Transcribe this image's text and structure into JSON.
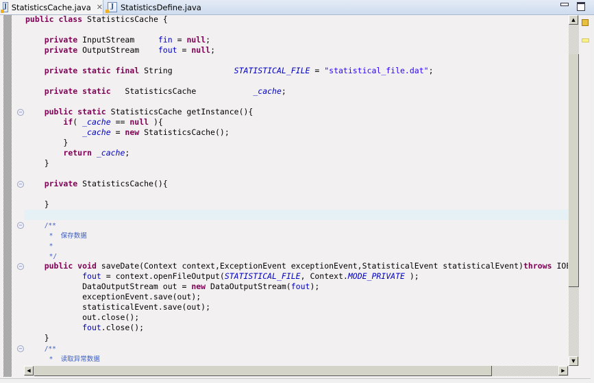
{
  "tabs": [
    {
      "label": "StatisticsCache.java",
      "active": true,
      "icon": "java-file-warning-icon",
      "close_icon": "close-icon"
    },
    {
      "label": "StatisticsDefine.java",
      "active": false,
      "icon": "java-file-warning-icon"
    }
  ],
  "window_controls": {
    "minimize": "minimize-icon",
    "maximize": "maximize-icon"
  },
  "colors": {
    "keyword": "#7f0055",
    "field": "#0000c0",
    "string": "#2a00ff",
    "javadoc": "#3f5fbf",
    "current_line": "#e6f1f5"
  },
  "fold_lines": [
    10,
    17,
    21,
    25,
    33
  ],
  "code_lines": [
    [
      [
        "k",
        "public class "
      ],
      [
        "t",
        "StatisticsCache {"
      ]
    ],
    [],
    [
      [
        "t",
        "    "
      ],
      [
        "k",
        "private "
      ],
      [
        "t",
        "InputStream     "
      ],
      [
        "f",
        "fin"
      ],
      [
        "t",
        " = "
      ],
      [
        "k",
        "null"
      ],
      [
        "t",
        ";"
      ]
    ],
    [
      [
        "t",
        "    "
      ],
      [
        "k",
        "private "
      ],
      [
        "t",
        "OutputStream    "
      ],
      [
        "f",
        "fout"
      ],
      [
        "t",
        " = "
      ],
      [
        "k",
        "null"
      ],
      [
        "t",
        ";"
      ]
    ],
    [],
    [
      [
        "t",
        "    "
      ],
      [
        "k",
        "private static final "
      ],
      [
        "t",
        "String             "
      ],
      [
        "s",
        "STATISTICAL_FILE"
      ],
      [
        "t",
        " = "
      ],
      [
        "str",
        "\"statistical_file.dat\""
      ],
      [
        "t",
        ";"
      ]
    ],
    [],
    [
      [
        "t",
        "    "
      ],
      [
        "k",
        "private static   "
      ],
      [
        "t",
        "StatisticsCache            "
      ],
      [
        "s",
        "_cache"
      ],
      [
        "t",
        ";"
      ]
    ],
    [],
    [
      [
        "t",
        "    "
      ],
      [
        "k",
        "public static "
      ],
      [
        "t",
        "StatisticsCache getInstance(){"
      ]
    ],
    [
      [
        "t",
        "        "
      ],
      [
        "k",
        "if"
      ],
      [
        "t",
        "( "
      ],
      [
        "s",
        "_cache"
      ],
      [
        "t",
        " == "
      ],
      [
        "k",
        "null"
      ],
      [
        "t",
        " ){"
      ]
    ],
    [
      [
        "t",
        "            "
      ],
      [
        "s",
        "_cache"
      ],
      [
        "t",
        " = "
      ],
      [
        "k",
        "new "
      ],
      [
        "t",
        "StatisticsCache();"
      ]
    ],
    [
      [
        "t",
        "        }"
      ]
    ],
    [
      [
        "t",
        "        "
      ],
      [
        "k",
        "return "
      ],
      [
        "s",
        "_cache"
      ],
      [
        "t",
        ";"
      ]
    ],
    [
      [
        "t",
        "    }"
      ]
    ],
    [],
    [
      [
        "t",
        "    "
      ],
      [
        "k",
        "private "
      ],
      [
        "t",
        "StatisticsCache(){"
      ]
    ],
    [],
    [
      [
        "t",
        "    }"
      ]
    ],
    [],
    [
      [
        "t",
        "    "
      ],
      [
        "c",
        "/**"
      ]
    ],
    [
      [
        "t",
        "     "
      ],
      [
        "c",
        "*  保存数据"
      ]
    ],
    [
      [
        "t",
        "     "
      ],
      [
        "c",
        "*"
      ]
    ],
    [
      [
        "t",
        "     "
      ],
      [
        "c",
        "*/"
      ]
    ],
    [
      [
        "t",
        "    "
      ],
      [
        "k",
        "public void "
      ],
      [
        "t",
        "saveDate(Context context,ExceptionEvent exceptionEvent,StatisticalEvent statisticalEvent)"
      ],
      [
        "k",
        "throws "
      ],
      [
        "t",
        "IOException{"
      ]
    ],
    [
      [
        "t",
        "            "
      ],
      [
        "f",
        "fout"
      ],
      [
        "t",
        " = context.openFileOutput("
      ],
      [
        "s",
        "STATISTICAL_FILE"
      ],
      [
        "t",
        ", Context."
      ],
      [
        "s",
        "MODE_PRIVATE"
      ],
      [
        "t",
        " );"
      ]
    ],
    [
      [
        "t",
        "            DataOutputStream out = "
      ],
      [
        "k",
        "new "
      ],
      [
        "t",
        "DataOutputStream("
      ],
      [
        "f",
        "fout"
      ],
      [
        "t",
        ");"
      ]
    ],
    [
      [
        "t",
        "            exceptionEvent.save(out);"
      ]
    ],
    [
      [
        "t",
        "            statisticalEvent.save(out);"
      ]
    ],
    [
      [
        "t",
        "            out.close();"
      ]
    ],
    [
      [
        "t",
        "            "
      ],
      [
        "f",
        "fout"
      ],
      [
        "t",
        ".close();"
      ]
    ],
    [
      [
        "t",
        "    }"
      ]
    ],
    [
      [
        "t",
        "    "
      ],
      [
        "c",
        "/**"
      ]
    ],
    [
      [
        "t",
        "     "
      ],
      [
        "c",
        "*  读取异常数据"
      ]
    ]
  ]
}
